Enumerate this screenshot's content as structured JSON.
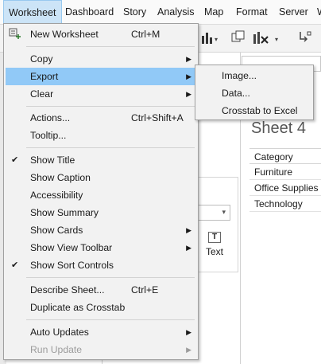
{
  "menubar": {
    "items": [
      "Worksheet",
      "Dashboard",
      "Story",
      "Analysis",
      "Map",
      "Format",
      "Server",
      "W"
    ]
  },
  "sheet": {
    "title": "Sheet 4",
    "category_header": "Category",
    "categories": [
      "Furniture",
      "Office Supplies",
      "Technology"
    ]
  },
  "marks_card": {
    "text_label": "Text"
  },
  "worksheet_menu": {
    "items": {
      "new_worksheet": {
        "label": "New Worksheet",
        "shortcut": "Ctrl+M"
      },
      "copy": {
        "label": "Copy"
      },
      "export": {
        "label": "Export"
      },
      "clear": {
        "label": "Clear"
      },
      "actions": {
        "label": "Actions...",
        "shortcut": "Ctrl+Shift+A"
      },
      "tooltip": {
        "label": "Tooltip..."
      },
      "show_title": {
        "label": "Show Title",
        "checked": true
      },
      "show_caption": {
        "label": "Show Caption"
      },
      "accessibility": {
        "label": "Accessibility"
      },
      "show_summary": {
        "label": "Show Summary"
      },
      "show_cards": {
        "label": "Show Cards"
      },
      "show_view_toolbar": {
        "label": "Show View Toolbar"
      },
      "show_sort_controls": {
        "label": "Show Sort Controls",
        "checked": true
      },
      "describe_sheet": {
        "label": "Describe Sheet...",
        "shortcut": "Ctrl+E"
      },
      "duplicate_as_crosstab": {
        "label": "Duplicate as Crosstab"
      },
      "auto_updates": {
        "label": "Auto Updates"
      },
      "run_update": {
        "label": "Run Update",
        "disabled": true
      }
    }
  },
  "export_submenu": {
    "items": [
      "Image...",
      "Data...",
      "Crosstab to Excel"
    ]
  },
  "colors": {
    "highlight": "#91c9f7",
    "menu_bg": "#f2f2f2",
    "menubar_active": "#cce4f7"
  }
}
